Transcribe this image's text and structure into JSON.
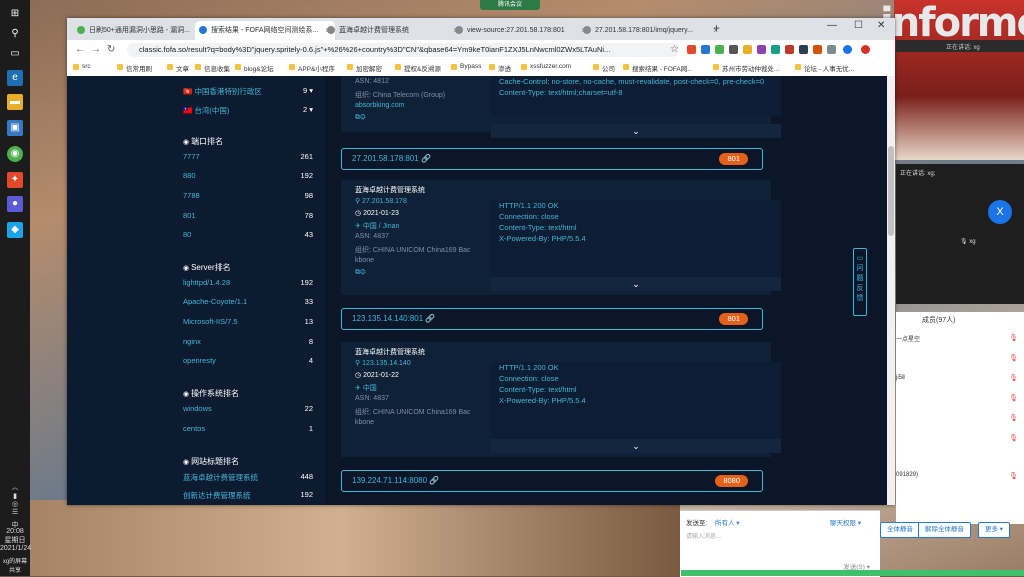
{
  "meeting": {
    "top_label": "腾讯会议",
    "mini_title": "正在讲话: xg;",
    "avatar_letter": "X",
    "speaker": "xg",
    "strip_label": "正在讲话: xg",
    "members_header": "成员(97人)",
    "members": [
      "一点星空",
      "",
      "ji5Ⅱ",
      "",
      "",
      "",
      "091829)"
    ],
    "chat_label": "发送至:",
    "chat_to": "所有人 ▾",
    "chat_perm": "聊天权限 ▾",
    "chat_hint": "请输入消息...",
    "chat_send": "发送(S) ▾",
    "btn_mute_all": "全体静音",
    "btn_unmute_all": "解除全体静音",
    "btn_more": "更多 ▾"
  },
  "taskbar": {
    "time": "20:08",
    "weekday": "星期日",
    "date": "2021/1/24",
    "lang": "中",
    "user": "xg",
    "user_status": "xg的屏幕共享"
  },
  "browser": {
    "tabs": [
      {
        "label": "日刷50+通用漏洞小思路 - 漏洞..."
      },
      {
        "label": "搜索结果 - FOFA网络空间测绘系..."
      },
      {
        "label": "蓝海卓越计费管理系统"
      },
      {
        "label": "view-source:27.201.58.178:801"
      },
      {
        "label": "27.201.58.178:801/imq/jquery..."
      }
    ],
    "url": "classic.fofa.so/result?q=body%3D\"jquery.spritely-0.6.js\"+%26%26+country%3D\"CN\"&qbase64=Ym9keT0ianF1ZXJ5LnNwcml0ZWx5LTAuNi...",
    "bookmarks": [
      "src",
      "信常用刷",
      "文章",
      "信息收集",
      "blog&论坛",
      "APP&小程序",
      "加密解密",
      "提权&反溯源",
      "Bypass",
      "渗透",
      "xssfuzzer.com",
      "公司",
      "搜索结果 - FOFA网...",
      "苏州市劳动仲裁处...",
      "论坛 - 人事无忧..."
    ]
  },
  "sidebar": {
    "country_rows": [
      {
        "label": "中国香港特别行政区",
        "count": "9 ▾"
      },
      {
        "label": "台湾(中国)",
        "count": "2 ▾"
      }
    ],
    "port_title": "端口排名",
    "ports": [
      {
        "label": "7777",
        "count": "261"
      },
      {
        "label": "880",
        "count": "192"
      },
      {
        "label": "7788",
        "count": "98"
      },
      {
        "label": "801",
        "count": "78"
      },
      {
        "label": "80",
        "count": "43"
      }
    ],
    "server_title": "Server排名",
    "servers": [
      {
        "label": "lighttpd/1.4.28",
        "count": "192"
      },
      {
        "label": "Apache-Coyote/1.1",
        "count": "33"
      },
      {
        "label": "Microsoft-IIS/7.5",
        "count": "13"
      },
      {
        "label": "nginx",
        "count": "8"
      },
      {
        "label": "openresty",
        "count": "4"
      }
    ],
    "os_title": "操作系统排名",
    "os": [
      {
        "label": "windows",
        "count": "22"
      },
      {
        "label": "centos",
        "count": "1"
      }
    ],
    "site_title": "网站标题排名",
    "sites": [
      {
        "label": "蓝海卓越计费管理系统",
        "count": "448"
      },
      {
        "label": "创新达计费管理系统",
        "count": "192"
      }
    ]
  },
  "results": {
    "top_card": {
      "asn": "ASN: 4812",
      "org": "组织: China Telecom (Group)",
      "domain": "absorbking.com",
      "http": "Cache-Control: no-store, no-cache, must-revalidate, post-check=0, pre-check=0\nContent-Type: text/html;charset=utf-8"
    },
    "ip1": {
      "ip": "27.201.58.178:801",
      "port": "801"
    },
    "card1": {
      "title": "蓝海卓越计费管理系统",
      "ip": "27.201.58.178",
      "date": "2021-01-23",
      "location": "中国 / Jinan",
      "asn_label": "ASN:",
      "asn": "4837",
      "org_label": "组织:",
      "org": "CHINA UNICOM China169 Bac",
      "org2": "kbone",
      "http": [
        "HTTP/1.1 200 OK",
        "Connection: close",
        "Content-Type: text/html",
        "X-Powered-By: PHP/5.5.4"
      ]
    },
    "ip2": {
      "ip": "123.135.14.140:801",
      "port": "801"
    },
    "card2": {
      "title": "蓝海卓越计费管理系统",
      "ip": "123.135.14.140",
      "date": "2021-01-22",
      "location": "中国",
      "asn_label": "ASN:",
      "asn": "4837",
      "org_label": "组织:",
      "org": "CHINA UNICOM China169 Bac",
      "org2": "kbone",
      "http": [
        "HTTP/1.1 200 OK",
        "Connection: close",
        "Content-Type: text/html",
        "X-Powered-By: PHP/5.5.4"
      ]
    },
    "ip3": {
      "ip": "139.224.71.114:8080",
      "port": "8080"
    }
  },
  "feedback": "问题反馈"
}
